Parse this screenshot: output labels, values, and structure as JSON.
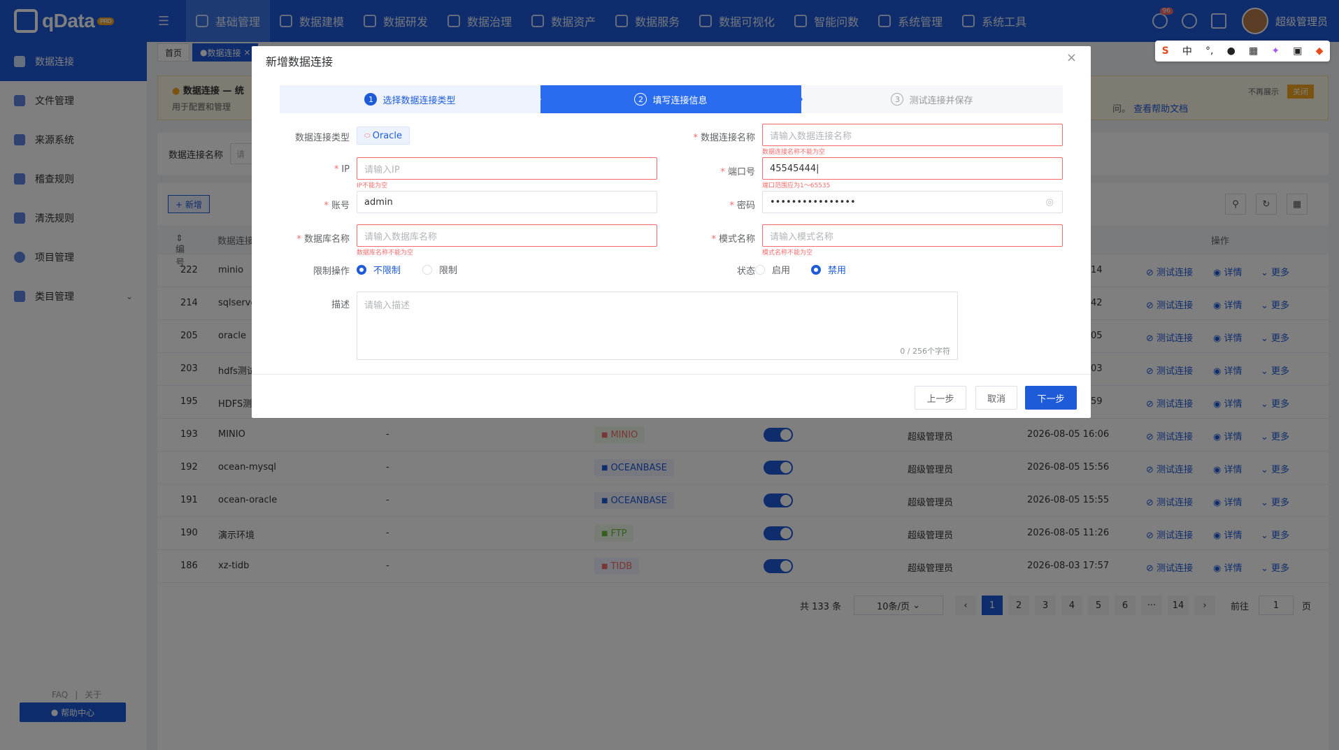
{
  "app": {
    "brand": "qData",
    "badge": "PRO"
  },
  "topnav": [
    {
      "label": "基础管理"
    },
    {
      "label": "数据建模"
    },
    {
      "label": "数据研发"
    },
    {
      "label": "数据治理"
    },
    {
      "label": "数据资产"
    },
    {
      "label": "数据服务"
    },
    {
      "label": "数据可视化"
    },
    {
      "label": "智能问数"
    },
    {
      "label": "系统管理"
    },
    {
      "label": "系统工具"
    }
  ],
  "user": {
    "name": "超级管理员",
    "notif_count": "96"
  },
  "ime": {
    "zh": "中"
  },
  "sidebar": [
    {
      "label": "数据连接"
    },
    {
      "label": "文件管理"
    },
    {
      "label": "来源系统"
    },
    {
      "label": "稽查规则"
    },
    {
      "label": "清洗规则"
    },
    {
      "label": "项目管理"
    },
    {
      "label": "类目管理"
    }
  ],
  "help": {
    "button": "帮助中心",
    "faq": "FAQ",
    "about": "关于"
  },
  "tabs": [
    {
      "label": "首页"
    },
    {
      "label": "数据连接"
    }
  ],
  "notice": {
    "title": "数据连接 — 统",
    "sub": "用于配置和管理",
    "tail": "问。",
    "link": "查看帮助文档",
    "no_more": "不再展示",
    "close": "关闭"
  },
  "filter": {
    "label": "数据连接名称",
    "placeholder": "请"
  },
  "table": {
    "add": "+ 新增",
    "headers": {
      "id": "编号",
      "name": "数据连接",
      "ops": "操作"
    },
    "rows": [
      {
        "id": "222",
        "name": "minio",
        "time_tail": "14"
      },
      {
        "id": "214",
        "name": "sqlserve",
        "time_tail": "42"
      },
      {
        "id": "205",
        "name": "oracle",
        "time_tail": "05"
      },
      {
        "id": "203",
        "name": "hdfs测试",
        "time_tail": "03"
      },
      {
        "id": "195",
        "name": "HDFS测",
        "time_tail": "59"
      },
      {
        "id": "193",
        "name": "MINIO",
        "desc": "-",
        "type": "MINIO",
        "owner": "超级管理员",
        "time": "2026-08-05 16:06"
      },
      {
        "id": "192",
        "name": "ocean-mysql",
        "desc": "-",
        "type": "OCEANBASE",
        "owner": "超级管理员",
        "time": "2026-08-05 15:56"
      },
      {
        "id": "191",
        "name": "ocean-oracle",
        "desc": "-",
        "type": "OCEANBASE",
        "owner": "超级管理员",
        "time": "2026-08-05 15:55"
      },
      {
        "id": "190",
        "name": "演示环境",
        "desc": "-",
        "type": "FTP",
        "owner": "超级管理员",
        "time": "2026-08-05 11:26"
      },
      {
        "id": "186",
        "name": "xz-tidb",
        "desc": "-",
        "type": "TIDB",
        "owner": "超级管理员",
        "time": "2026-08-03 17:57"
      }
    ],
    "actions": {
      "test": "测试连接",
      "detail": "详情",
      "more": "更多"
    }
  },
  "pager": {
    "total": "共 133 条",
    "size": "10条/页",
    "pages": [
      "1",
      "2",
      "3",
      "4",
      "5",
      "6",
      "···",
      "14"
    ],
    "goto": "前往",
    "page_val": "1",
    "page_unit": "页"
  },
  "dialog": {
    "title": "新增数据连接",
    "steps": [
      {
        "num": "1",
        "label": "选择数据连接类型"
      },
      {
        "num": "2",
        "label": "填写连接信息"
      },
      {
        "num": "3",
        "label": "测试连接并保存"
      }
    ],
    "fields": {
      "type_label": "数据连接类型",
      "type_value": "Oracle",
      "name_label": "数据连接名称",
      "name_ph": "请输入数据连接名称",
      "name_err": "数据连接名称不能为空",
      "ip_label": "IP",
      "ip_ph": "请输入IP",
      "ip_err": "IP不能为空",
      "port_label": "端口号",
      "port_value": "45545444",
      "port_err": "端口范围应为1～65535",
      "account_label": "账号",
      "account_value": "admin",
      "pwd_label": "密码",
      "pwd_value": "••••••••••••••••",
      "db_label": "数据库名称",
      "db_ph": "请输入数据库名称",
      "db_err": "数据库名称不能为空",
      "schema_label": "模式名称",
      "schema_ph": "请输入模式名称",
      "schema_err": "模式名称不能为空",
      "limit_label": "限制操作",
      "limit_opt1": "不限制",
      "limit_opt2": "限制",
      "status_label": "状态",
      "status_opt1": "启用",
      "status_opt2": "禁用",
      "desc_label": "描述",
      "desc_ph": "请输入描述",
      "desc_count": "0 / 256个字符"
    },
    "buttons": {
      "prev": "上一步",
      "cancel": "取消",
      "next": "下一步"
    }
  }
}
